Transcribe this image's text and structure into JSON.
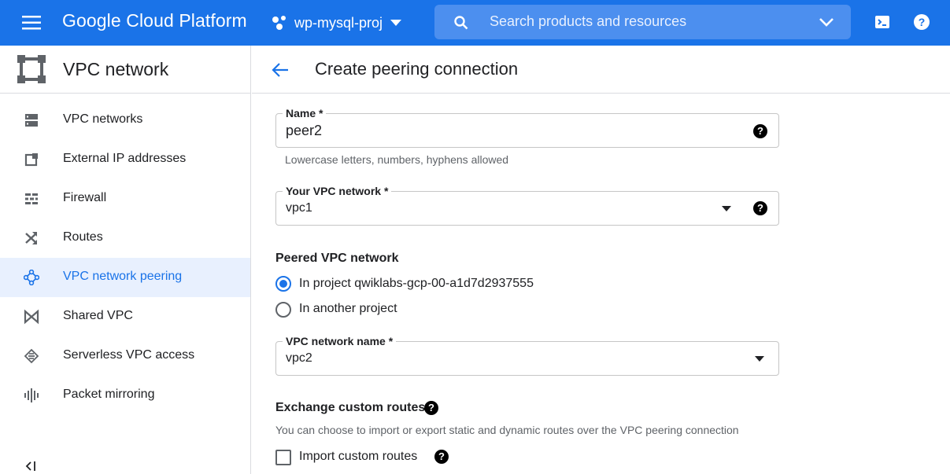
{
  "topbar": {
    "brand": "Google Cloud Platform",
    "project": "wp-mysql-proj",
    "search_placeholder": "Search products and resources",
    "color": "#1a73e8"
  },
  "sidebar": {
    "title": "VPC network",
    "items": [
      {
        "label": "VPC networks",
        "icon": "vpc-networks-icon"
      },
      {
        "label": "External IP addresses",
        "icon": "external-ip-icon"
      },
      {
        "label": "Firewall",
        "icon": "firewall-icon"
      },
      {
        "label": "Routes",
        "icon": "routes-icon"
      },
      {
        "label": "VPC network peering",
        "icon": "peering-icon",
        "active": true
      },
      {
        "label": "Shared VPC",
        "icon": "shared-vpc-icon"
      },
      {
        "label": "Serverless VPC access",
        "icon": "serverless-icon"
      },
      {
        "label": "Packet mirroring",
        "icon": "packet-mirroring-icon"
      }
    ],
    "collapse_glyph": "<|"
  },
  "page": {
    "title": "Create peering connection"
  },
  "form": {
    "name": {
      "label": "Name *",
      "value": "peer2",
      "hint": "Lowercase letters, numbers, hyphens allowed"
    },
    "your_vpc": {
      "label": "Your VPC network *",
      "value": "vpc1"
    },
    "peered": {
      "heading": "Peered VPC network",
      "options": [
        {
          "label": "In project qwiklabs-gcp-00-a1d7d2937555",
          "selected": true
        },
        {
          "label": "In another project",
          "selected": false
        }
      ]
    },
    "vpc_name": {
      "label": "VPC network name *",
      "value": "vpc2"
    },
    "exchange": {
      "heading": "Exchange custom routes",
      "description": "You can choose to import or export static and dynamic routes over the VPC peering connection",
      "import_label": "Import custom routes",
      "import_checked": false
    },
    "help_glyph": "?"
  }
}
